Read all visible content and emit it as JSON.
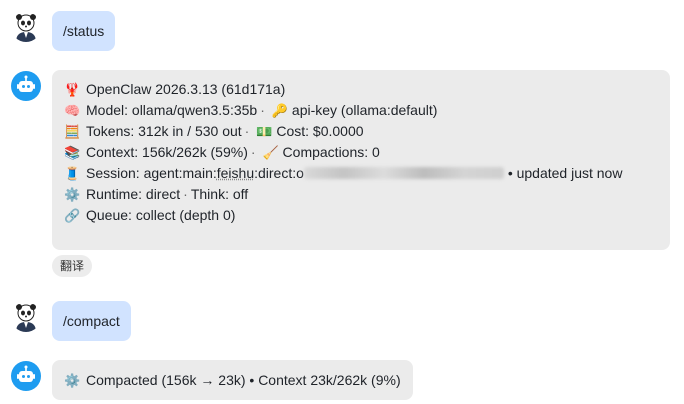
{
  "messages": {
    "status_cmd": "/status",
    "status_reply": {
      "line1": "OpenClaw 2026.3.13 (61d171a)",
      "model": "Model: ollama/qwen3.5:35b",
      "apikey": "api-key (ollama:default)",
      "tokens": "Tokens: 312k in / 530 out",
      "cost": "Cost: $0.0000",
      "context": "Context: 156k/262k (59%)",
      "compactions": "Compactions: 0",
      "session_prefix": "Session: agent:main:",
      "session_link": "feishu",
      "session_after": ":direct:o",
      "session_suffix": "• updated just now",
      "runtime": "Runtime: direct",
      "think": "Think: off",
      "queue": "Queue: collect (depth 0)"
    },
    "translate_label": "翻译",
    "compact_cmd": "/compact",
    "compact_reply": "Compacted (156k → 23k) • Context 23k/262k (9%)"
  },
  "icons": {
    "lobster": "🦞",
    "brain": "🧠",
    "key": "🔑",
    "abacus": "🧮",
    "money": "💵",
    "books": "📚",
    "broom": "🧹",
    "thread": "🧵",
    "gear": "⚙️",
    "link": "🔗"
  }
}
